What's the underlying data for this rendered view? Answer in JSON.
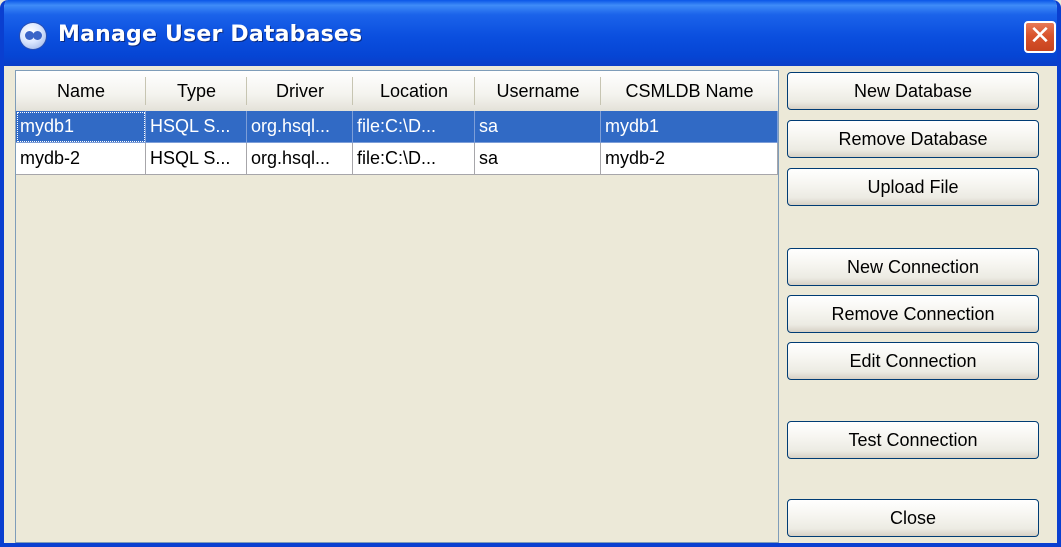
{
  "window": {
    "title": "Manage User Databases",
    "close_glyph": "✕"
  },
  "table": {
    "columns": [
      "Name",
      "Type",
      "Driver",
      "Location",
      "Username",
      "CSMLDB Name"
    ],
    "rows": [
      {
        "cells": [
          "mydb1",
          "HSQL S...",
          "org.hsql...",
          "file:C:\\D...",
          "sa",
          "mydb1"
        ],
        "selected": true
      },
      {
        "cells": [
          "mydb-2",
          "HSQL S...",
          "org.hsql...",
          "file:C:\\D...",
          "sa",
          "mydb-2"
        ],
        "selected": false
      }
    ]
  },
  "buttons": {
    "new_database": "New Database",
    "remove_database": "Remove Database",
    "upload_file": "Upload File",
    "new_connection": "New Connection",
    "remove_connection": "Remove Connection",
    "edit_connection": "Edit Connection",
    "test_connection": "Test Connection",
    "close": "Close"
  },
  "colors": {
    "titlebar": "#0a4fdf",
    "selection": "#316ac5",
    "window_bg": "#ece9d8",
    "close_button": "#d9532c"
  }
}
